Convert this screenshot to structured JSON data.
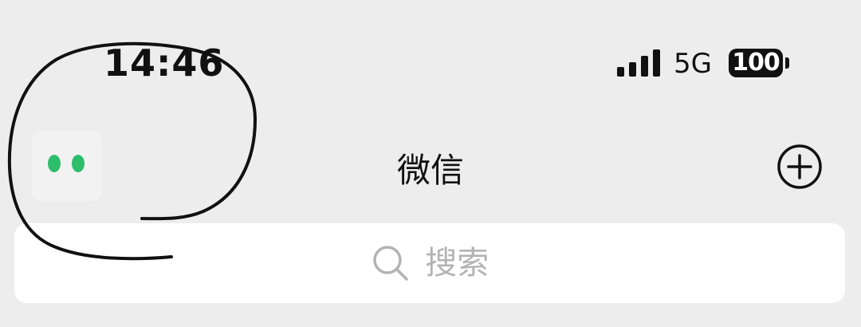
{
  "status_bar": {
    "time": "14:46",
    "network": "5G",
    "battery": "100"
  },
  "header": {
    "title": "微信"
  },
  "search": {
    "placeholder": "搜索"
  },
  "colors": {
    "background": "#ededed",
    "mini_program_dots": "#2ebd6b",
    "search_background": "#ffffff",
    "placeholder_text": "#b3b3b3",
    "annotation_ink": "#111111"
  },
  "icons": {
    "signal": "cellular-signal-icon",
    "battery": "battery-icon",
    "mini_program": "mini-program-dots-icon",
    "add": "plus-circle-icon",
    "search": "magnifier-icon"
  }
}
